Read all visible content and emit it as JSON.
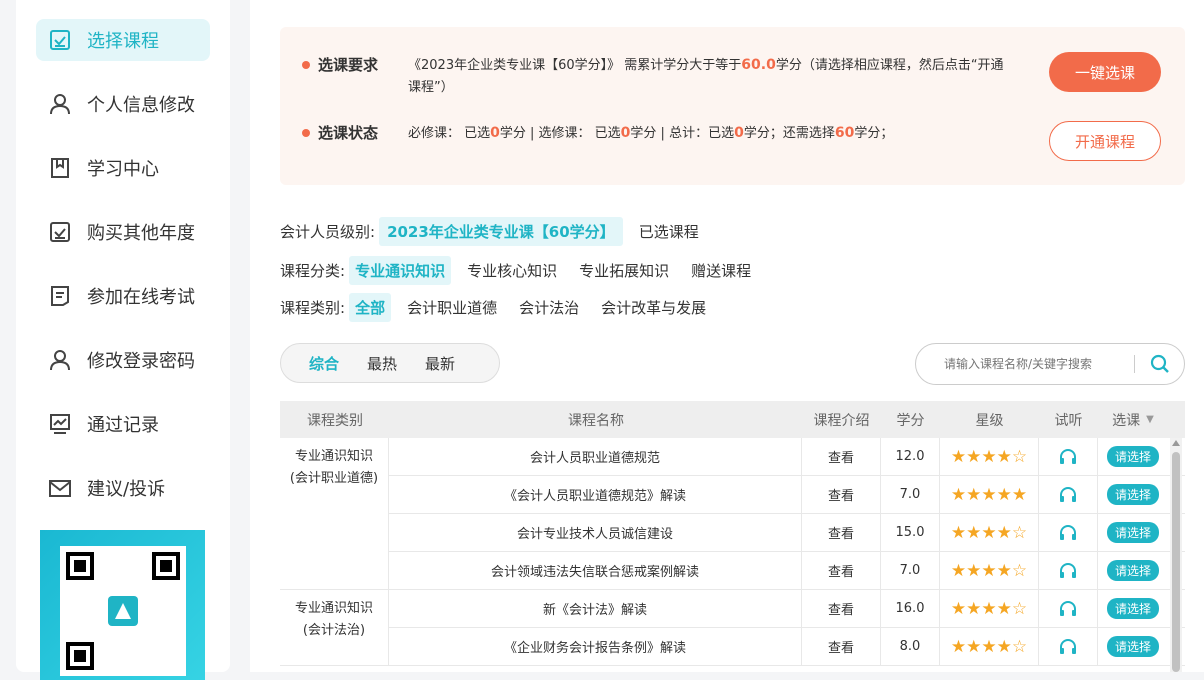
{
  "sidebar": {
    "items": [
      {
        "label": "选择课程",
        "icon": "checkbox-icon",
        "active": true
      },
      {
        "label": "个人信息修改",
        "icon": "user-icon"
      },
      {
        "label": "学习中心",
        "icon": "bookmark-icon"
      },
      {
        "label": "购买其他年度",
        "icon": "checkbox-icon"
      },
      {
        "label": "参加在线考试",
        "icon": "document-icon"
      },
      {
        "label": "修改登录密码",
        "icon": "user-icon"
      },
      {
        "label": "通过记录",
        "icon": "chart-icon"
      },
      {
        "label": "建议/投诉",
        "icon": "mail-icon"
      }
    ]
  },
  "requirements": {
    "req_label": "选课要求",
    "req_text_pre": "《2023年企业类专业课【60学分】》 需累计学分大于等于",
    "req_value": "60.0",
    "req_text_post": "学分（请选择相应课程，然后点击“开通课程”）",
    "status_label": "选课状态",
    "status": {
      "t1": "必修课： 已选",
      "v1": "0",
      "t2": "学分 | 选修课： 已选",
      "v2": "0",
      "t3": "学分 | 总计：已选",
      "v3": "0",
      "t4": "学分；还需选择",
      "v4": "60",
      "t5": "学分；"
    },
    "btn_one_click": "一键选课",
    "btn_open": "开通课程"
  },
  "filters": {
    "level_label": "会计人员级别:",
    "level_value": "2023年企业类专业课【60学分】",
    "level_selected": "已选课程",
    "category_label": "课程分类:",
    "categories": [
      "专业通识知识",
      "专业核心知识",
      "专业拓展知识",
      "赠送课程"
    ],
    "type_label": "课程类别:",
    "types": [
      "全部",
      "会计职业道德",
      "会计法治",
      "会计改革与发展"
    ]
  },
  "sort": {
    "options": [
      "综合",
      "最热",
      "最新"
    ]
  },
  "search": {
    "placeholder": "请输入课程名称/关键字搜索"
  },
  "table": {
    "headers": [
      "课程类别",
      "课程名称",
      "课程介绍",
      "学分",
      "星级",
      "试听",
      "选课"
    ],
    "groups": [
      {
        "category_line1": "专业通识知识",
        "category_line2": "(会计职业道德)",
        "rows": [
          {
            "name": "会计人员职业道德规范",
            "intro": "查看",
            "credit": "12.0",
            "stars": 4,
            "pick": "请选择"
          },
          {
            "name": "《会计人员职业道德规范》解读",
            "intro": "查看",
            "credit": "7.0",
            "stars": 5,
            "pick": "请选择"
          },
          {
            "name": "会计专业技术人员诚信建设",
            "intro": "查看",
            "credit": "15.0",
            "stars": 4,
            "pick": "请选择"
          },
          {
            "name": "会计领域违法失信联合惩戒案例解读",
            "intro": "查看",
            "credit": "7.0",
            "stars": 4,
            "pick": "请选择"
          }
        ]
      },
      {
        "category_line1": "专业通识知识",
        "category_line2": "(会计法治)",
        "rows": [
          {
            "name": "新《会计法》解读",
            "intro": "查看",
            "credit": "16.0",
            "stars": 4,
            "pick": "请选择"
          },
          {
            "name": "《企业财务会计报告条例》解读",
            "intro": "查看",
            "credit": "8.0",
            "stars": 4,
            "pick": "请选择"
          }
        ]
      }
    ]
  },
  "colors": {
    "accent": "#1fb4c5",
    "orange": "#f26b4a",
    "star": "#f5a623"
  }
}
